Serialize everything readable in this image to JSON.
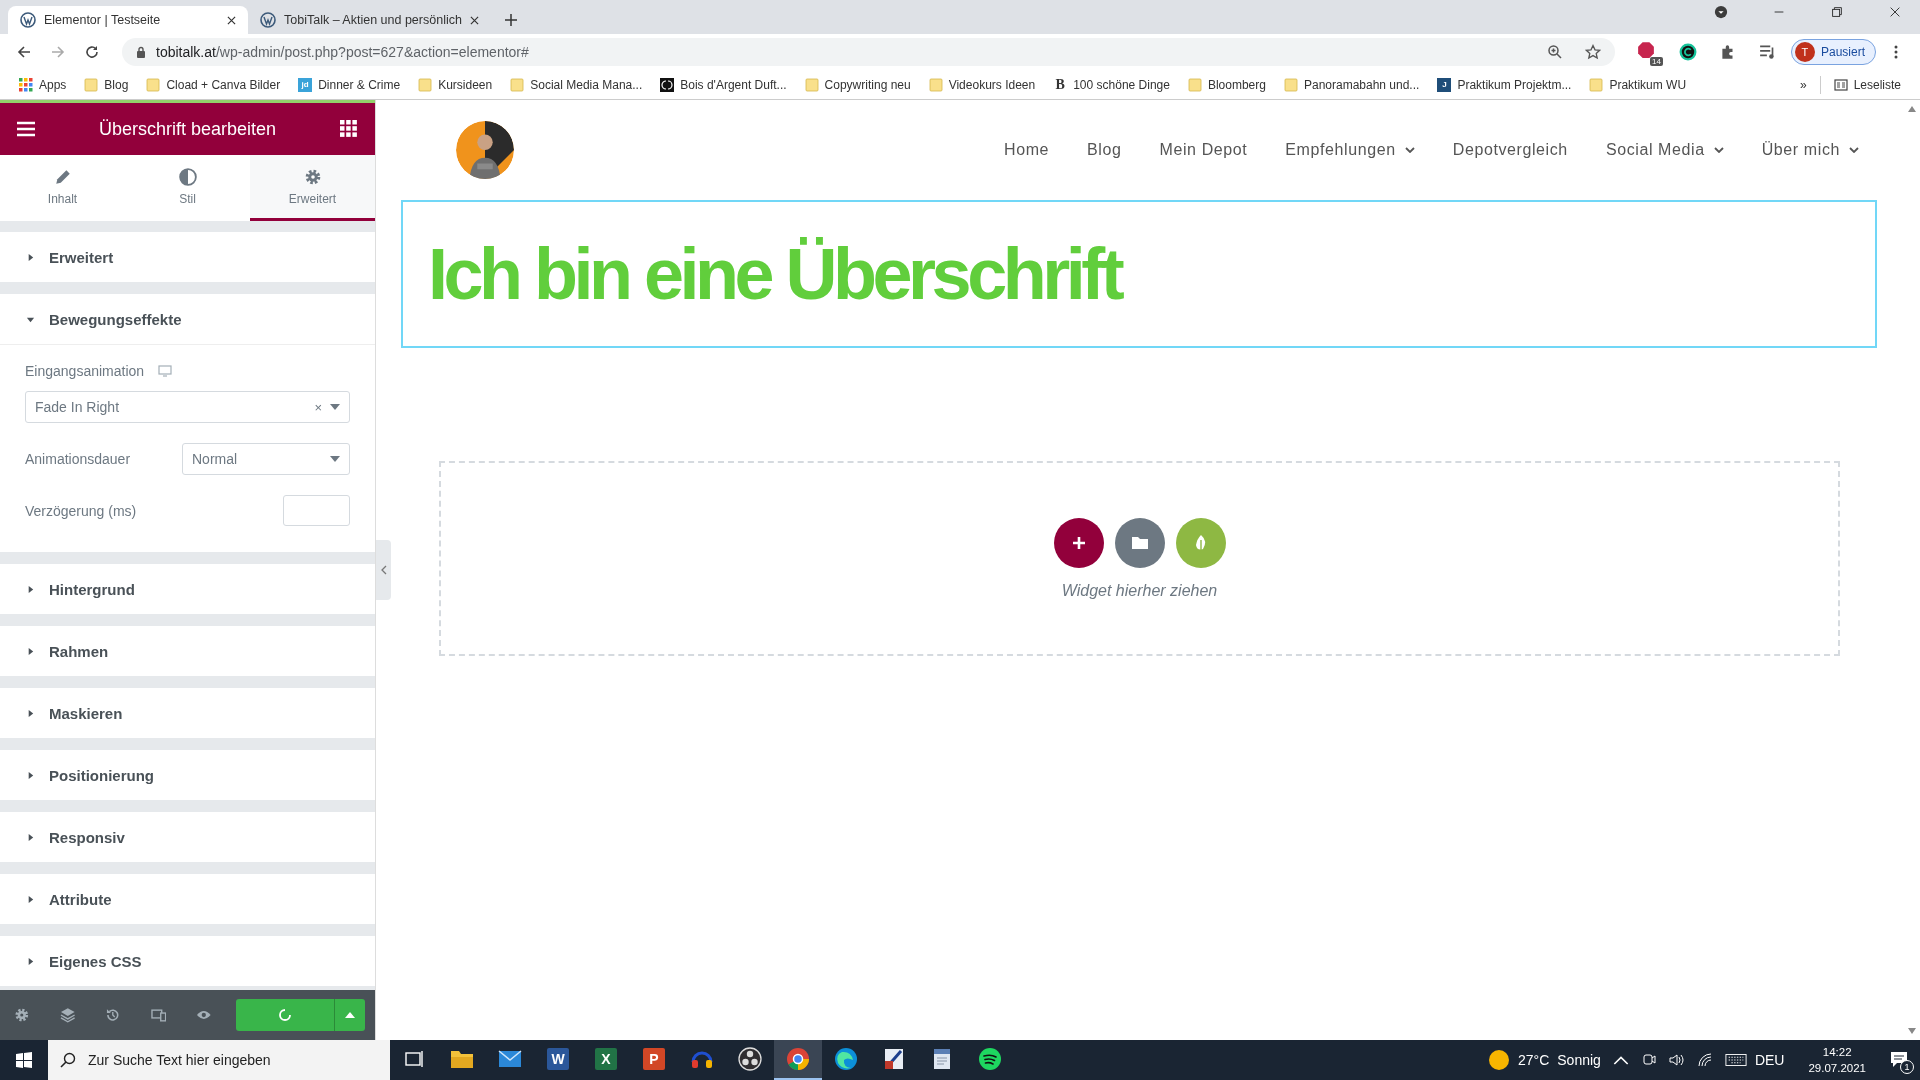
{
  "browser": {
    "tabs": [
      {
        "title": "Elementor | Testseite",
        "selected": true
      },
      {
        "title": "TobiTalk – Aktien und persönlich",
        "selected": false
      }
    ],
    "url_host": "tobitalk.at",
    "url_path": "/wp-admin/post.php?post=627&action=elementor#",
    "extensions": [
      {
        "kind": "abp",
        "badge": "14"
      },
      {
        "kind": "grammarly"
      },
      {
        "kind": "puzzle"
      },
      {
        "kind": "media"
      }
    ],
    "profile": {
      "initial": "T",
      "label": "Pausiert"
    },
    "bookmarks": [
      {
        "kind": "apps",
        "label": "Apps"
      },
      {
        "kind": "folder",
        "label": "Blog"
      },
      {
        "kind": "folder",
        "label": "Cload + Canva Bilder"
      },
      {
        "kind": "logo",
        "logo_text": "jd",
        "color": "#3aa3d9",
        "label": "Dinner & Crime"
      },
      {
        "kind": "folder",
        "label": "Kursideen"
      },
      {
        "kind": "folder",
        "label": "Social Media Mana..."
      },
      {
        "kind": "dark",
        "label": "Bois d'Argent Duft..."
      },
      {
        "kind": "folder",
        "label": "Copywriting neu"
      },
      {
        "kind": "folder",
        "label": "Videokurs Ideen"
      },
      {
        "kind": "letter",
        "logo_text": "B",
        "label": "100 schöne Dinge"
      },
      {
        "kind": "folder",
        "label": "Bloomberg"
      },
      {
        "kind": "folder",
        "label": "Panoramabahn und..."
      },
      {
        "kind": "logo",
        "logo_text": "J",
        "color": "#1f4e79",
        "label": "Praktikum Projektm..."
      },
      {
        "kind": "folder",
        "label": "Praktikum WU"
      }
    ],
    "overflow": "»",
    "reading_list": "Leseliste"
  },
  "panel": {
    "title": "Überschrift bearbeiten",
    "tabs": [
      {
        "kind": "pencil",
        "label": "Inhalt",
        "selected": false
      },
      {
        "kind": "contrast",
        "label": "Stil",
        "selected": false
      },
      {
        "kind": "gear",
        "label": "Erweitert",
        "selected": true
      }
    ],
    "sections": [
      {
        "title": "Erweitert",
        "expanded": false
      },
      {
        "title": "Bewegungseffekte",
        "expanded": true,
        "fields": [
          {
            "kind": "select-wide",
            "label": "Eingangsanimation",
            "device_icon": true,
            "value": "Fade In Right",
            "clear": "×"
          },
          {
            "kind": "select",
            "label": "Animationsdauer",
            "value": "Normal"
          },
          {
            "kind": "number",
            "label": "Verzögerung (ms)"
          }
        ]
      },
      {
        "title": "Hintergrund",
        "expanded": false
      },
      {
        "title": "Rahmen",
        "expanded": false
      },
      {
        "title": "Maskieren",
        "expanded": false
      },
      {
        "title": "Positionierung",
        "expanded": false
      },
      {
        "title": "Responsiv",
        "expanded": false
      },
      {
        "title": "Attribute",
        "expanded": false
      },
      {
        "title": "Eigenes CSS",
        "expanded": false
      }
    ]
  },
  "site": {
    "nav": [
      {
        "label": "Home",
        "dropdown": false
      },
      {
        "label": "Blog",
        "dropdown": false
      },
      {
        "label": "Mein Depot",
        "dropdown": false
      },
      {
        "label": "Empfehlungen",
        "dropdown": true
      },
      {
        "label": "Depotvergleich",
        "dropdown": false
      },
      {
        "label": "Social Media",
        "dropdown": true
      },
      {
        "label": "Über mich",
        "dropdown": true
      }
    ],
    "heading": "Ich bin eine Überschrift",
    "drop_hint": "Widget hierher ziehen"
  },
  "taskbar": {
    "search_placeholder": "Zur Suche Text hier eingeben",
    "apps": [
      {
        "kind": "taskview",
        "selected": false
      },
      {
        "kind": "explorer",
        "selected": false
      },
      {
        "kind": "mail",
        "selected": false
      },
      {
        "kind": "office",
        "glyph": "W",
        "color": "#2b579a",
        "selected": false
      },
      {
        "kind": "office",
        "glyph": "X",
        "color": "#217346",
        "selected": false
      },
      {
        "kind": "office",
        "glyph": "P",
        "color": "#d24726",
        "selected": false
      },
      {
        "kind": "audio",
        "selected": false
      },
      {
        "kind": "obs",
        "selected": false
      },
      {
        "kind": "chrome",
        "selected": true
      },
      {
        "kind": "edge",
        "selected": false
      },
      {
        "kind": "tool",
        "selected": false
      },
      {
        "kind": "doc",
        "selected": false
      },
      {
        "kind": "spotify",
        "selected": false
      }
    ],
    "weather": "27°C",
    "weather_text": "Sonnig",
    "language": "DEU",
    "time": "14:22",
    "date": "29.07.2021",
    "notifications": "1"
  }
}
